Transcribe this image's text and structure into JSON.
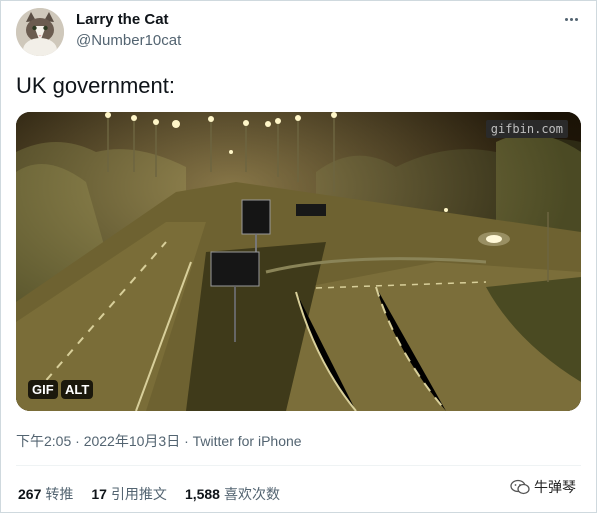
{
  "author": {
    "name": "Larry the Cat",
    "handle": "@Number10cat",
    "avatar_icon": "cat-avatar"
  },
  "tweet": {
    "text": "UK government:"
  },
  "media": {
    "type": "gif",
    "watermark": "gifbin.com",
    "gif_badge": "GIF",
    "alt_badge": "ALT"
  },
  "meta": {
    "time_source": "下午2:05 · 2022年10月3日 · Twitter for iPhone"
  },
  "stats": {
    "retweets_count": "267",
    "retweets_label": "转推",
    "quotes_count": "17",
    "quotes_label": "引用推文",
    "likes_count": "1,588",
    "likes_label": "喜欢次数"
  },
  "watermark_brand": {
    "text": "牛弹琴",
    "icon": "wechat-icon"
  },
  "colors": {
    "text_primary": "#0f1419",
    "text_secondary": "#536471",
    "border": "#cfd9de"
  }
}
